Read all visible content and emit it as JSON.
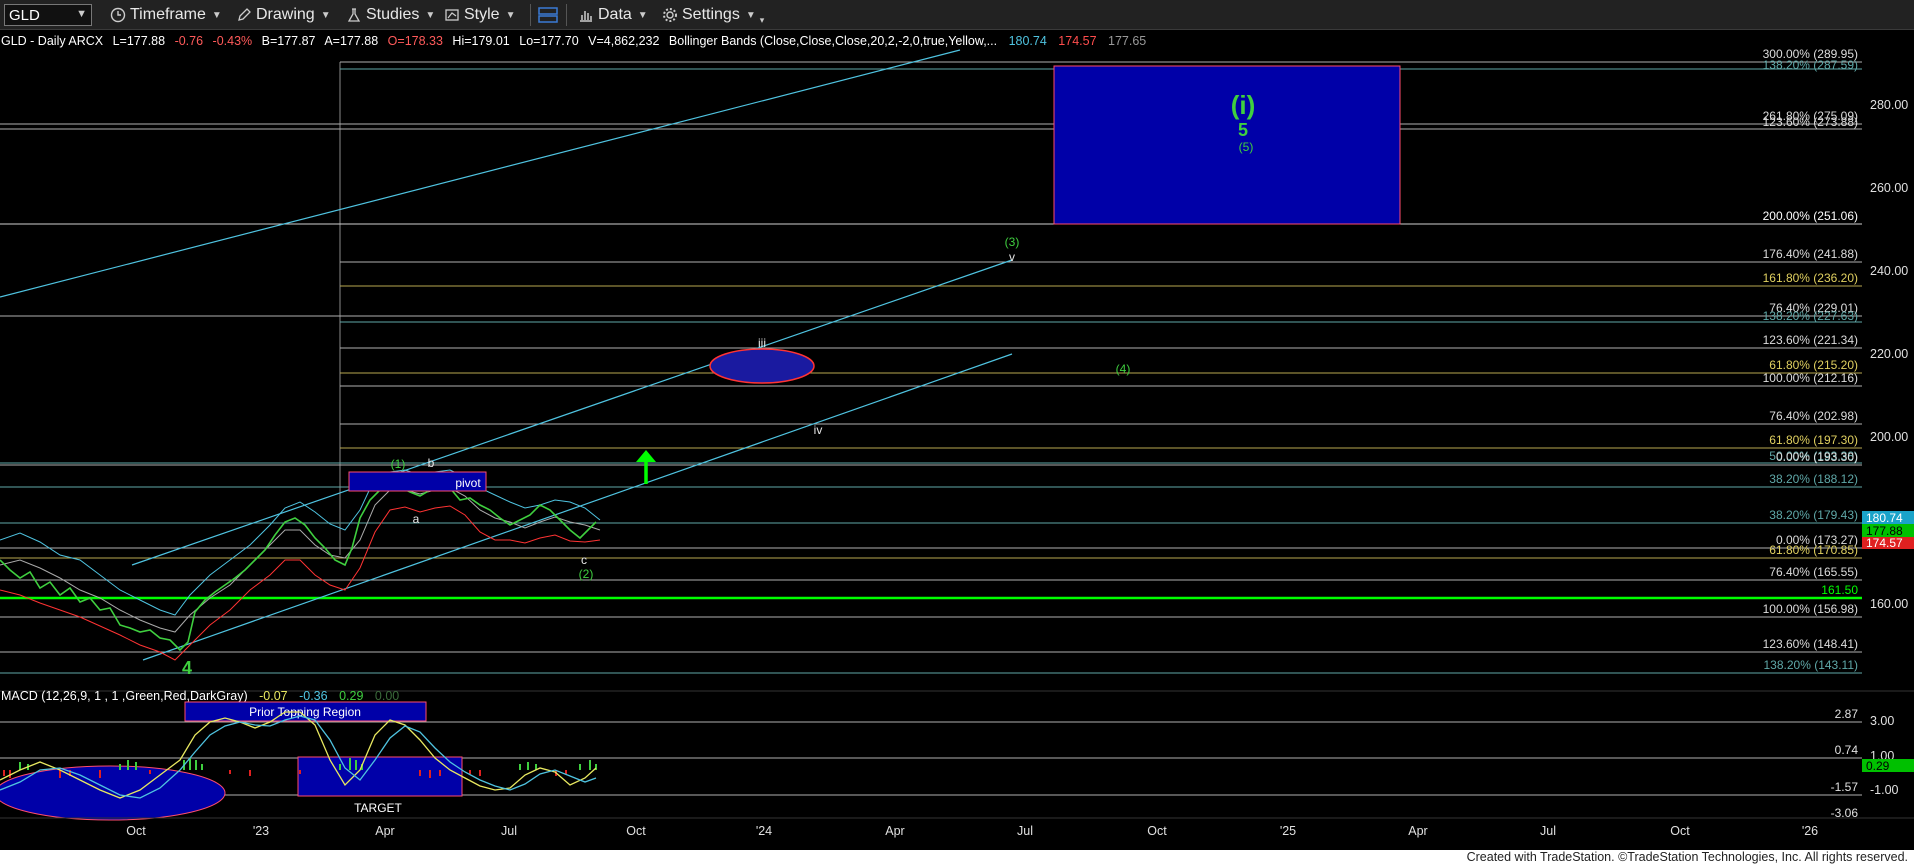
{
  "toolbar": {
    "symbol": "GLD",
    "timeframe": "Timeframe",
    "drawing": "Drawing",
    "studies": "Studies",
    "style": "Style",
    "data": "Data",
    "settings": "Settings"
  },
  "header": {
    "title": "GLD - Daily  ARCX",
    "last": "L=177.88",
    "change": "-0.76",
    "change_pct": "-0.43%",
    "bid": "B=177.87",
    "ask": "A=177.88",
    "open": "O=178.33",
    "high": "Hi=179.01",
    "low": "Lo=177.70",
    "volume": "V=4,862,232",
    "bb_study": "Bollinger Bands (Close,Close,Close,20,2,-2,0,true,Yellow,...",
    "bb_upper": "180.74",
    "bb_lower": "174.57",
    "bb_mid": "177.65"
  },
  "macd_header": {
    "label": "MACD (12,26,9, 1 , 1 ,Green,Red,DarkGray)",
    "macd": "-0.07",
    "signal": "-0.36",
    "hist": "0.29",
    "zero": "0.00"
  },
  "price_axis": [
    "280.00",
    "260.00",
    "240.00",
    "220.00",
    "200.00",
    "160.00"
  ],
  "macd_axis": [
    "3.00",
    "1.00",
    "-1.00"
  ],
  "time_axis": [
    "Oct",
    "'23",
    "Apr",
    "Jul",
    "Oct",
    "'24",
    "Apr",
    "Jul",
    "Oct",
    "'25",
    "Apr",
    "Jul",
    "Oct",
    "'26"
  ],
  "price_tags": {
    "bb_upper": "180.74",
    "last": "177.88",
    "bb_lower": "174.57",
    "macd_hist": "0.29"
  },
  "fib_levels": [
    {
      "label": "300.00% (289.95)",
      "color": "#dcdcdc"
    },
    {
      "label": "138.20% (287.59)",
      "color": "#5fa8a8"
    },
    {
      "label": "261.80% (275.09)",
      "color": "#dcdcdc"
    },
    {
      "label": "123.60% (273.88)",
      "color": "#dcdcdc"
    },
    {
      "label": "200.00% (251.06)",
      "color": "#ffffff"
    },
    {
      "label": "176.40% (241.88)",
      "color": "#dcdcdc"
    },
    {
      "label": "161.80% (236.20)",
      "color": "#e0d060"
    },
    {
      "label": "76.40% (229.01)",
      "color": "#dcdcdc"
    },
    {
      "label": "138.20% (227.63)",
      "color": "#5fa8a8"
    },
    {
      "label": "123.60% (221.34)",
      "color": "#dcdcdc"
    },
    {
      "label": "61.80% (215.20)",
      "color": "#e0d060"
    },
    {
      "label": "100.00% (212.16)",
      "color": "#dcdcdc"
    },
    {
      "label": "76.40% (202.98)",
      "color": "#dcdcdc"
    },
    {
      "label": "61.80% (197.30)",
      "color": "#e0d060"
    },
    {
      "label": "50.00% (193.38)",
      "color": "#5fa8a8"
    },
    {
      "label": "0.00% (193.30)",
      "color": "#dcdcdc"
    },
    {
      "label": "38.20% (188.12)",
      "color": "#5fa8a8"
    },
    {
      "label": "38.20% (179.43)",
      "color": "#5fa8a8"
    },
    {
      "label": "0.00% (173.27)",
      "color": "#dcdcdc"
    },
    {
      "label": "61.80% (170.85)",
      "color": "#e0d060"
    },
    {
      "label": "76.40% (165.55)",
      "color": "#dcdcdc"
    },
    {
      "label": "161.50",
      "color": "#00ff00"
    },
    {
      "label": "100.00% (156.98)",
      "color": "#dcdcdc"
    },
    {
      "label": "123.60% (148.41)",
      "color": "#dcdcdc"
    },
    {
      "label": "138.20% (143.11)",
      "color": "#5fa8a8"
    }
  ],
  "macd_levels": [
    "2.87",
    "0.74",
    "-1.57",
    "-3.06"
  ],
  "annotations": {
    "wave_i": "(i)",
    "wave_5": "5",
    "wave_5p": "(5)",
    "wave_3p": "(3)",
    "wave_v": "v",
    "wave_iii": "iii",
    "wave_4p": "(4)",
    "wave_iv": "iv",
    "wave_1p": "(1)",
    "wave_b": "b",
    "pivot": "pivot",
    "wave_a": "a",
    "wave_c": "c",
    "wave_2p": "(2)",
    "wave_4": "4",
    "prior_topping": "Prior Topping Region",
    "target": "TARGET"
  },
  "footer": "Created with TradeStation. ©TradeStation Technologies, Inc. All rights reserved."
}
